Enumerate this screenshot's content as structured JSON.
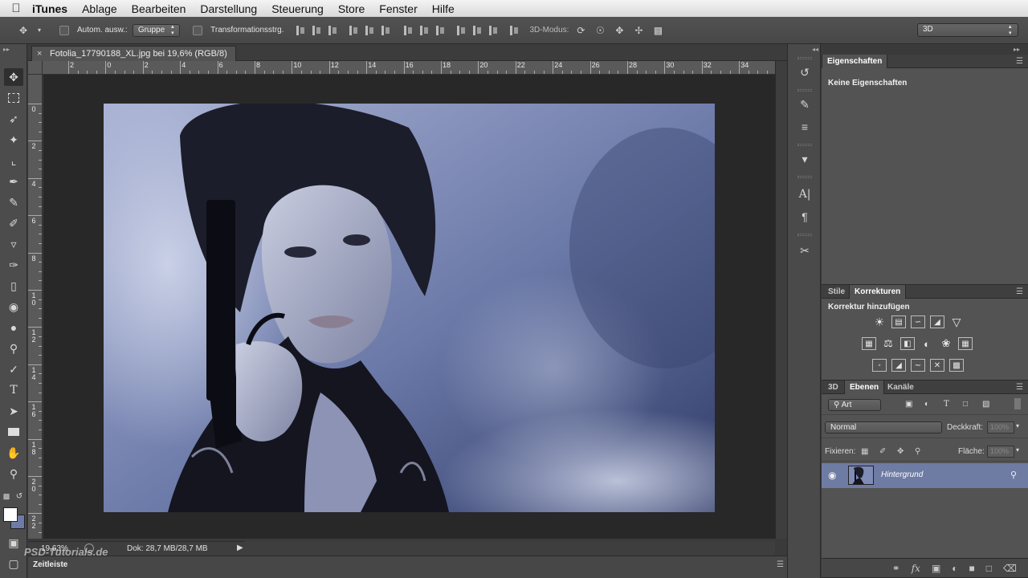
{
  "menubar": {
    "apple": "",
    "app": "iTunes",
    "items": [
      "Ablage",
      "Bearbeiten",
      "Darstellung",
      "Steuerung",
      "Store",
      "Fenster",
      "Hilfe"
    ]
  },
  "options_bar": {
    "auto_select_label": "Autom. ausw.:",
    "auto_select_value": "Gruppe",
    "transform_label": "Transformationsstrg.",
    "mode3d_label": "3D-Modus:",
    "workspace_value": "3D"
  },
  "document": {
    "tab_title": "Fotolia_17790188_XL.jpg bei 19,6% (RGB/8)",
    "close_glyph": "×",
    "zoom": "19,63%",
    "doc_info": "Dok: 28,7 MB/28,7 MB"
  },
  "rulers": {
    "top_labels": [
      "2",
      "0",
      "2",
      "4",
      "6",
      "8",
      "10",
      "12",
      "14",
      "16",
      "18",
      "20",
      "22",
      "24",
      "26",
      "28",
      "30",
      "32",
      "34"
    ],
    "left_labels": [
      "0",
      "2",
      "4",
      "6",
      "8",
      "10",
      "12",
      "14",
      "16",
      "18",
      "20",
      "22"
    ]
  },
  "timeline": {
    "tab": "Zeitleiste"
  },
  "watermark": "PSD-Tutorials.de",
  "properties_panel": {
    "tab": "Eigenschaften",
    "content": "Keine Eigenschaften"
  },
  "adjustments_panel": {
    "tabs": [
      "Stile",
      "Korrekturen"
    ],
    "title": "Korrektur hinzufügen"
  },
  "layers_panel": {
    "tabs": [
      "3D",
      "Ebenen",
      "Kanäle"
    ],
    "filter_value": "Art",
    "blend_mode": "Normal",
    "opacity_label": "Deckkraft:",
    "opacity_value": "100%",
    "lock_label": "Fixieren:",
    "fill_label": "Fläche:",
    "fill_value": "100%",
    "layers": [
      {
        "name": "Hintergrund",
        "locked": true,
        "visible": true
      }
    ]
  },
  "colors": {
    "foreground": "#ffffff",
    "background": "#6e7ba8",
    "selected_layer": "#6e7ba3"
  }
}
